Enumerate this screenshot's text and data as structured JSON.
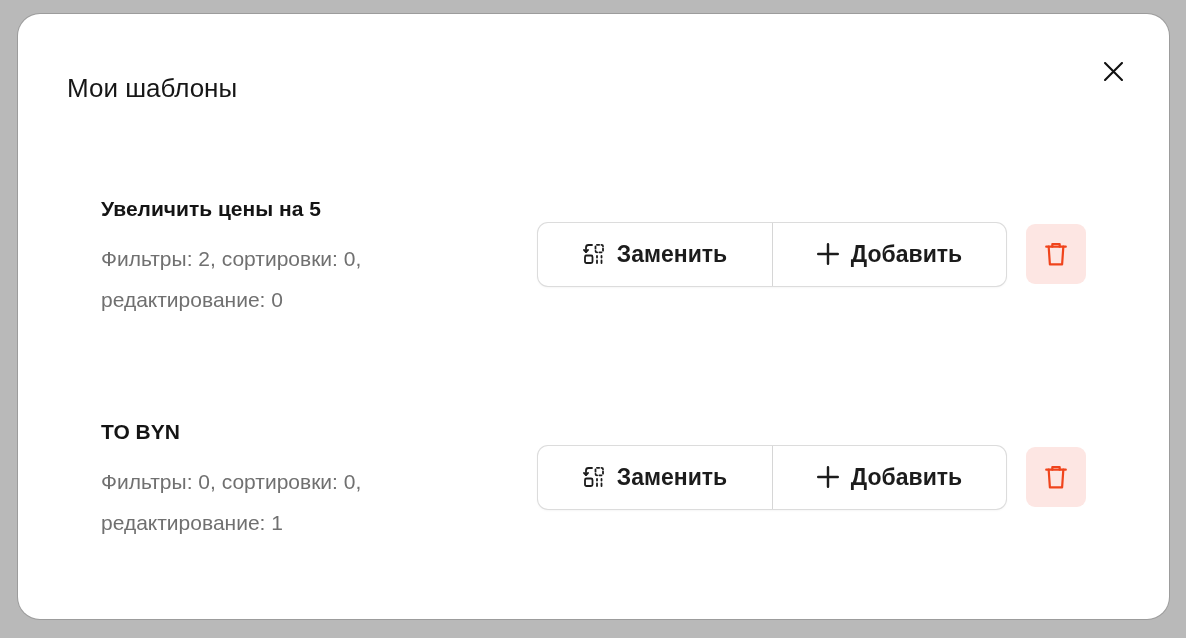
{
  "dialog": {
    "title": "Мои шаблоны"
  },
  "templates": [
    {
      "name": "Увеличить цены на 5",
      "summary": "Фильтры: 2, сортировки: 0, редактирование: 0",
      "actions": [
        {
          "kind": "replace",
          "label": "Заменить"
        },
        {
          "kind": "add",
          "label": "Добавить"
        }
      ]
    },
    {
      "name": "TO BYN",
      "summary": "Фильтры: 0, сортировки: 0, редактирование: 1",
      "actions": [
        {
          "kind": "replace",
          "label": "Заменить"
        },
        {
          "kind": "add",
          "label": "Добавить"
        }
      ]
    }
  ]
}
